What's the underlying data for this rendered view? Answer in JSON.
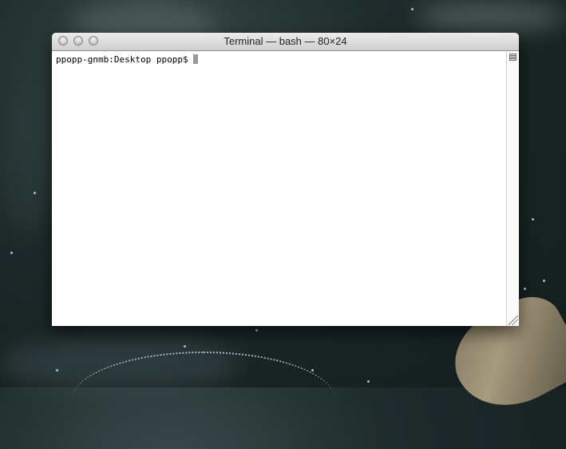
{
  "window": {
    "title": "Terminal — bash — 80×24"
  },
  "terminal": {
    "prompt": "ppopp-gnmb:Desktop ppopp$ "
  }
}
